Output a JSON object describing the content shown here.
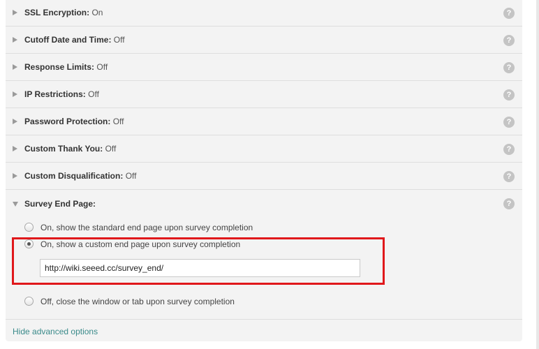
{
  "sections": [
    {
      "label": "SSL Encryption:",
      "value": "On"
    },
    {
      "label": "Cutoff Date and Time:",
      "value": "Off"
    },
    {
      "label": "Response Limits:",
      "value": "Off"
    },
    {
      "label": "IP Restrictions:",
      "value": "Off"
    },
    {
      "label": "Password Protection:",
      "value": "Off"
    },
    {
      "label": "Custom Thank You:",
      "value": "Off"
    },
    {
      "label": "Custom Disqualification:",
      "value": "Off"
    }
  ],
  "help_glyph": "?",
  "end_page": {
    "title": "Survey End Page:",
    "options": [
      {
        "label": "On, show the standard end page upon survey completion",
        "checked": false
      },
      {
        "label": "On, show a custom end page upon survey completion",
        "checked": true
      },
      {
        "label": "Off, close the window or tab upon survey completion",
        "checked": false
      }
    ],
    "url_value": "http://wiki.seeed.cc/survey_end/"
  },
  "footer": {
    "hide_link": "Hide advanced options"
  },
  "colors": {
    "panel_bg": "#f3f3f3",
    "highlight": "#e0181b",
    "link": "#3a8a8a"
  },
  "icons": {
    "collapsed": "triangle-right-icon",
    "expanded": "triangle-down-icon",
    "help": "question-circle-icon"
  }
}
